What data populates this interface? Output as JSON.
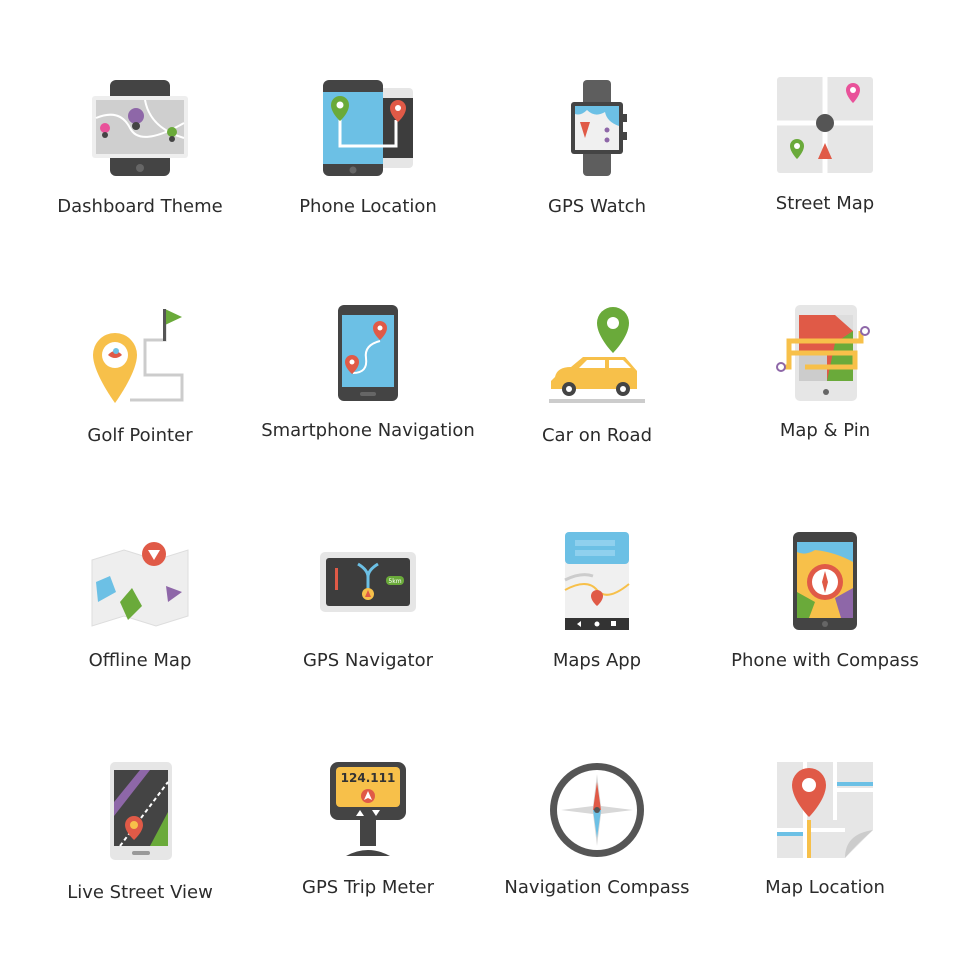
{
  "icons": [
    {
      "label": "Dashboard Theme",
      "icon": "dashboard-theme-icon"
    },
    {
      "label": "Phone Location",
      "icon": "phone-location-icon"
    },
    {
      "label": "GPS Watch",
      "icon": "gps-watch-icon"
    },
    {
      "label": "Street Map",
      "icon": "street-map-icon"
    },
    {
      "label": "Golf Pointer",
      "icon": "golf-pointer-icon"
    },
    {
      "label": "Smartphone Navigation",
      "icon": "smartphone-navigation-icon"
    },
    {
      "label": "Car on Road",
      "icon": "car-on-road-icon"
    },
    {
      "label": "Map & Pin",
      "icon": "map-and-pin-icon"
    },
    {
      "label": "Offline Map",
      "icon": "offline-map-icon"
    },
    {
      "label": "GPS Navigator",
      "icon": "gps-navigator-icon",
      "screen_text": "5km"
    },
    {
      "label": "Maps App",
      "icon": "maps-app-icon"
    },
    {
      "label": "Phone with Compass",
      "icon": "phone-with-compass-icon"
    },
    {
      "label": "Live Street View",
      "icon": "live-street-view-icon"
    },
    {
      "label": "GPS Trip Meter",
      "icon": "gps-trip-meter-icon",
      "screen_text": "124.111"
    },
    {
      "label": "Navigation Compass",
      "icon": "navigation-compass-icon"
    },
    {
      "label": "Map Location",
      "icon": "map-location-icon"
    }
  ],
  "colors": {
    "dark": "#444444",
    "blue": "#6cc0e5",
    "red": "#e05a47",
    "green": "#6aaa3a",
    "yellow": "#f7c04a",
    "purple": "#8e67a8",
    "pink": "#e9529a",
    "grey": "#e6e6e6"
  }
}
